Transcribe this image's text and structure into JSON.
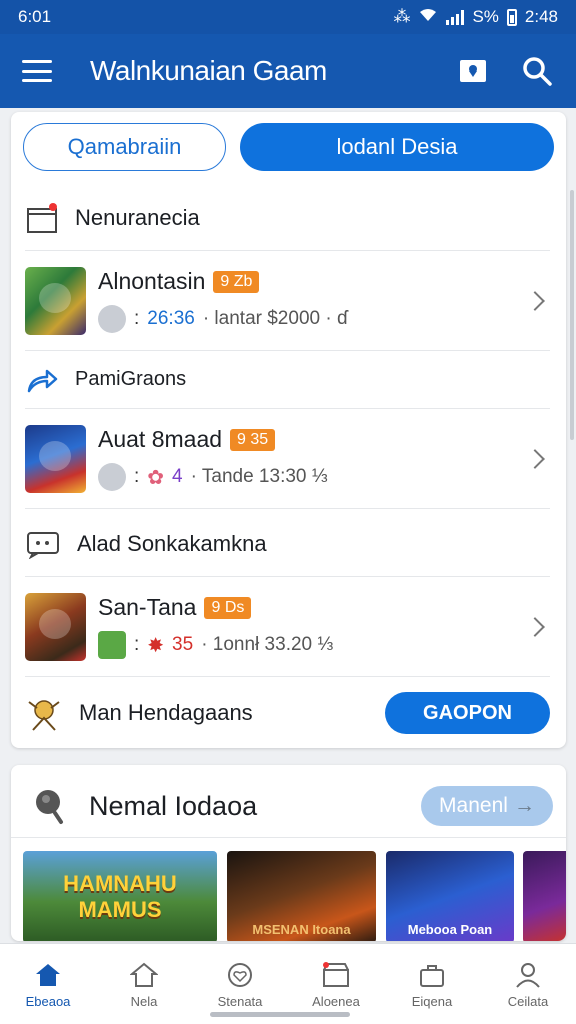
{
  "status_bar": {
    "time": "6:01",
    "battery": "S%",
    "clock": "2:48"
  },
  "app_bar": {
    "title": "Walnkunaian Gaam"
  },
  "tabs": [
    {
      "label": "Qamabraiin"
    },
    {
      "label": "lodanl Desia"
    }
  ],
  "sections": [
    {
      "label": "Nenuranecia",
      "icon": "box-icon"
    },
    {
      "label": "PamiGraons",
      "icon": "share-arrow-icon"
    },
    {
      "label": "Alad Sonkakamkna",
      "icon": "chat-icon"
    },
    {
      "label": "Man Hendagaans",
      "icon": "character-icon",
      "button": "GAOPON"
    }
  ],
  "games": [
    {
      "name": "Alnontasin",
      "badge": "9 Zb",
      "value": "26:36",
      "desc": "· lantar $2000 · ɗ"
    },
    {
      "name": "Auat 8maad",
      "badge": "9 35",
      "value": "4",
      "desc": "· Tande   13:30 ⅓"
    },
    {
      "name": "San-Tana",
      "badge": "9 Ds",
      "value": "35",
      "desc": "· 1onnł   33.20 ⅓"
    }
  ],
  "featured": {
    "title": "Nemal Iodaoa",
    "more_label": "Manenl",
    "promos": [
      {
        "label": "",
        "big": "HAMNAHU MAMUS"
      },
      {
        "label": "MSENAN Itoana"
      },
      {
        "label": "Mebooa Poan"
      },
      {
        "label": ""
      }
    ]
  },
  "bottom_nav": [
    {
      "label": "Ebeaoa",
      "icon": "home-icon"
    },
    {
      "label": "Nela",
      "icon": "house-outline-icon"
    },
    {
      "label": "Stenata",
      "icon": "heart-icon"
    },
    {
      "label": "Aloenea",
      "icon": "store-icon"
    },
    {
      "label": "Eiqena",
      "icon": "briefcase-icon"
    },
    {
      "label": "Ceilata",
      "icon": "person-icon"
    }
  ],
  "colors": {
    "primary": "#1558b0",
    "accent": "#0f72dd",
    "badge": "#f08a24"
  }
}
